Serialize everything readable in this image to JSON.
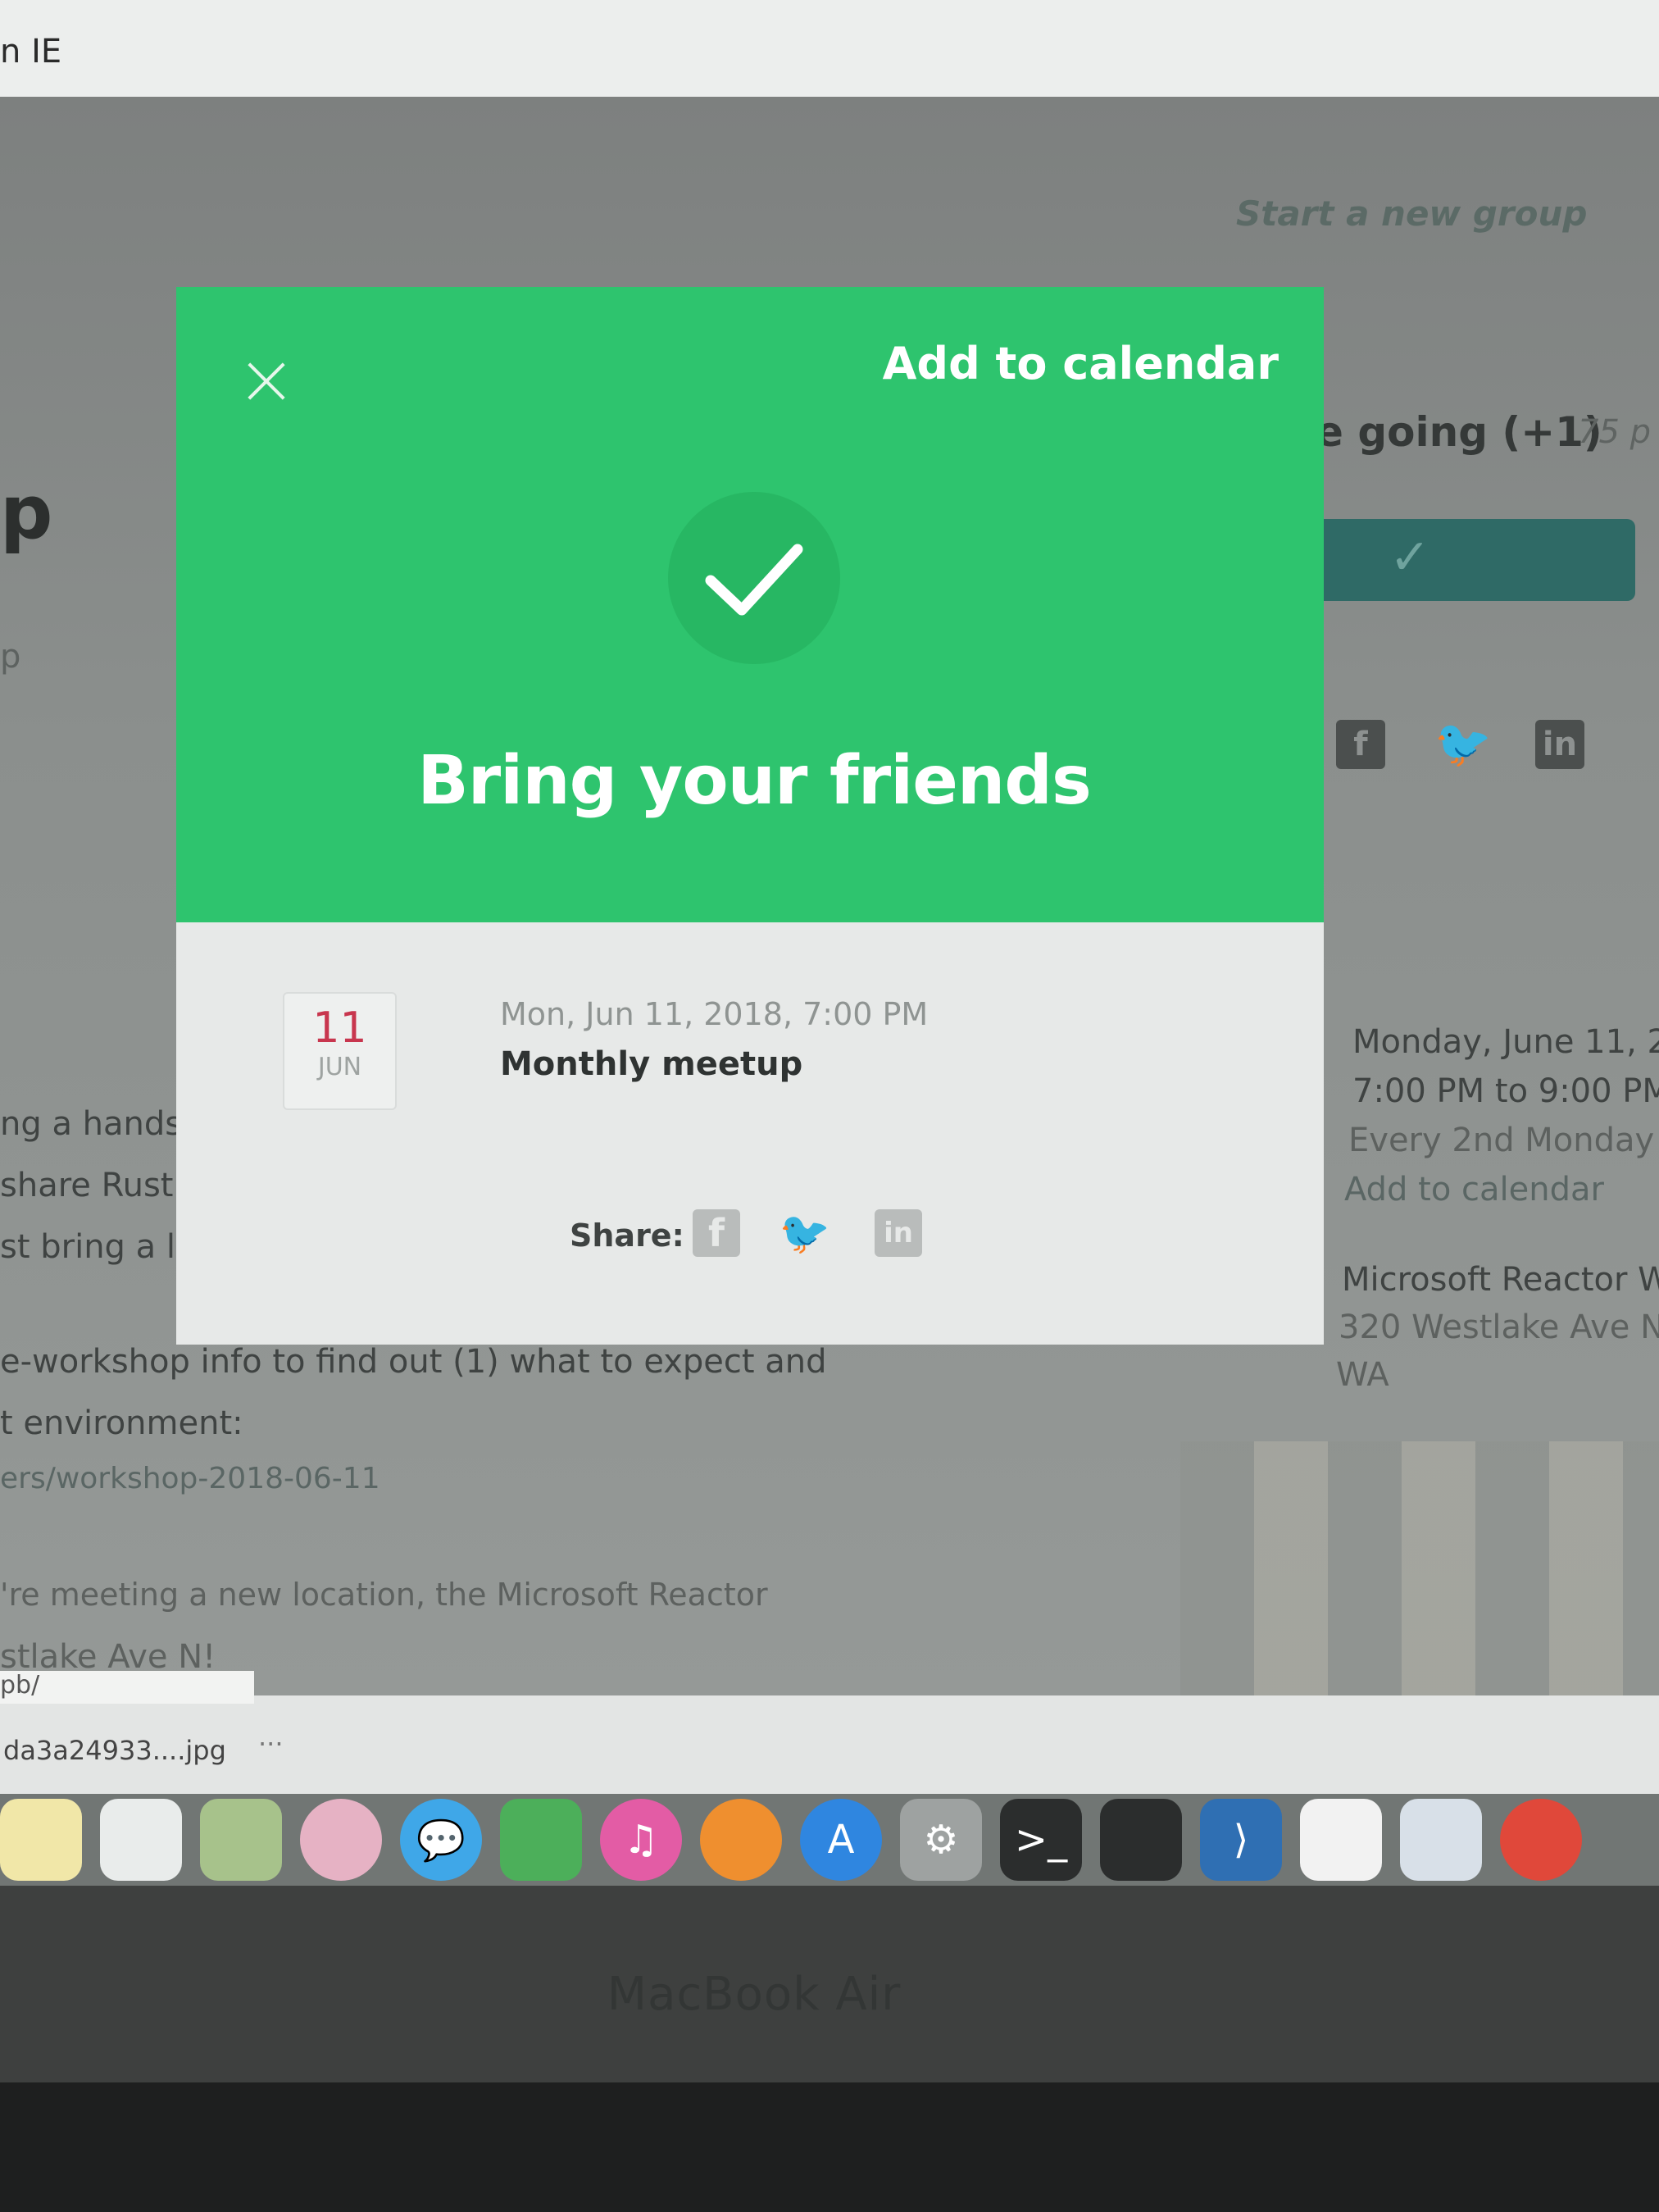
{
  "browser": {
    "tab_title": "n IE"
  },
  "background_page": {
    "start_group": "Start a new group",
    "going": "e going (+1)",
    "going_count": "75 p",
    "big_letter": "p",
    "small_letter": "p",
    "share_icons": [
      "facebook-icon",
      "twitter-icon",
      "linkedin-icon"
    ],
    "event_details": {
      "date_line": "Monday, June 11, 2",
      "time_line": "7:00 PM to 9:00 PM",
      "recurrence": "Every 2nd Monday",
      "add_to_calendar": "Add to calendar",
      "venue_name": "Microsoft Reactor W",
      "venue_address": "320 Westlake Ave N",
      "venue_state": "WA"
    },
    "description": [
      "ng a hands-o",
      "share Rust ex",
      "st bring a lapt",
      "e-workshop info to find out (1) what to expect and",
      "t environment:",
      "ers/workshop-2018-06-11",
      "'re meeting a new location, the Microsoft Reactor",
      "stlake Ave N!"
    ]
  },
  "modal": {
    "close_icon": "close-icon",
    "add_to_calendar": "Add to calendar",
    "check_icon": "checkmark-icon",
    "title": "Bring your friends",
    "date_day": "11",
    "date_month": "JUN",
    "event_datetime": "Mon, Jun 11, 2018, 7:00 PM",
    "event_name": "Monthly meetup",
    "share_label": "Share:",
    "share_buttons": [
      "facebook-icon",
      "twitter-icon",
      "linkedin-icon"
    ]
  },
  "downloads": {
    "prev_item": "pb/",
    "file_name": "da3a24933....jpg",
    "more": "···"
  },
  "hardware": {
    "label": "MacBook Air"
  },
  "colors": {
    "accent_green": "#2ec46e",
    "date_red": "#c8364e",
    "rsvp_teal": "#2f6a66"
  }
}
